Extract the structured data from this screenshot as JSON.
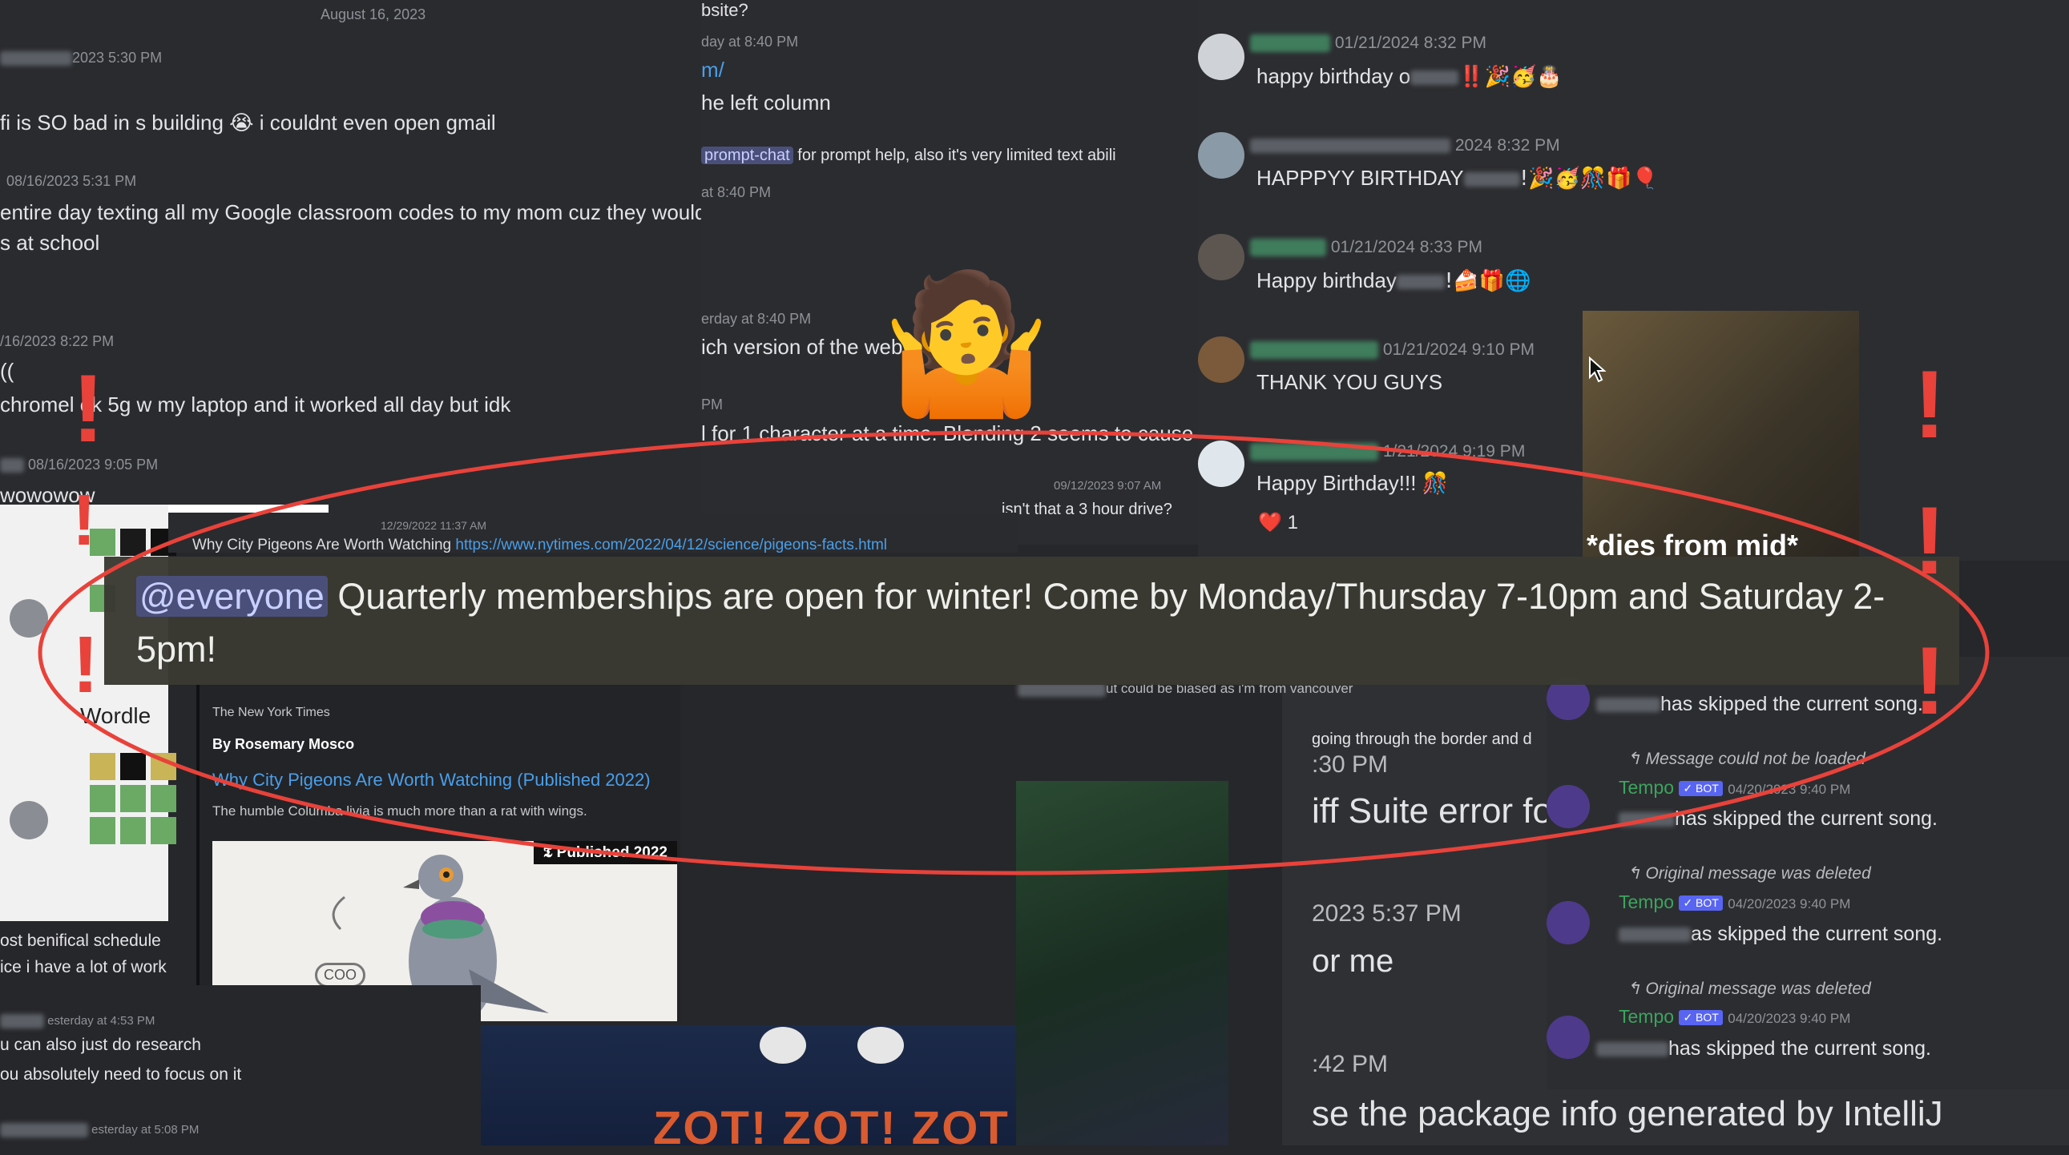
{
  "left_panel": {
    "date_divider": "August 16, 2023",
    "messages": [
      {
        "ts": "2023 5:30 PM",
        "text": "fi is SO bad in s building",
        "text2": "i couldnt even open gmail",
        "emoji": "😭"
      },
      {
        "ts": "08/16/2023 5:31 PM",
        "text": "entire day texting all my Google classroom codes to my mom cuz they wouldn",
        "text2": "s at school"
      },
      {
        "ts": "/16/2023 8:22 PM",
        "text": "((",
        "text2": "chromel    ok 5g w my laptop and it worked all day but idk"
      },
      {
        "ts": "08/16/2023 9:05 PM",
        "text": "wowowow"
      }
    ],
    "wordle_label": "Wordle",
    "bottom_lines": [
      "ost benifical schedule",
      "ice i have a lot of work"
    ],
    "bottom_ts": "esterday at 4:53 PM",
    "bottom_msgs": [
      "u can also just do research",
      "ou absolutely need to focus on it"
    ],
    "bottom_ts2": "esterday at 5:08 PM"
  },
  "mid_panel": {
    "lines": [
      {
        "ts": "",
        "text": "bsite?"
      },
      {
        "ts": "day at 8:40 PM",
        "text": "m/",
        "link": true
      },
      {
        "ts": "",
        "text": "he left column"
      },
      {
        "ts": "",
        "channel": "prompt-chat",
        "text": "for prompt help, also it's very limited text abili"
      },
      {
        "ts": "at 8:40 PM",
        "text": ""
      },
      {
        "ts": "erday at 8:40 PM",
        "text": "ich version of the webs"
      },
      {
        "ts": "PM",
        "text": "l for 1 character at a time. Blending 2 seems to cause e"
      }
    ],
    "ts_small": "09/12/2023 9:07 AM",
    "msg_small": "isn't that a 3 hour drive?",
    "shrug_emoji": "🤷"
  },
  "nyt": {
    "ts": "12/29/2022 11:37 AM",
    "title_line": "Why City Pigeons Are Worth Watching",
    "url": "https://www.nytimes.com/2022/04/12/science/pigeons-facts.html",
    "source": "The New York Times",
    "byline": "By Rosemary Mosco",
    "headline": "Why City Pigeons Are Worth Watching (Published 2022)",
    "desc": "The humble Columba livia is much more than a rat with wings.",
    "badge": "Published 2022",
    "coo": "COO"
  },
  "right_panel": {
    "messages": [
      {
        "ts": "01/21/2024 8:32 PM",
        "text": "happy birthday o",
        "emoji": "‼️🎉🥳🎂"
      },
      {
        "ts": "2024 8:32 PM",
        "text": "HAPPPYY BIRTHDAY",
        "emoji": "!🎉🥳🎊🎁🎈"
      },
      {
        "ts": "01/21/2024 8:33 PM",
        "text": "Happy birthday",
        "emoji": "!🍰🎁🌐"
      },
      {
        "ts": "01/21/2024 9:10 PM",
        "text": "THANK YOU GUYS"
      },
      {
        "ts": "1/21/2024 9:19 PM",
        "text": "Happy Birthday!!!",
        "emoji": "🎊"
      }
    ],
    "reaction": "❤️",
    "reaction_count": "1",
    "gif_caption": "*dies from mid*"
  },
  "banner": {
    "mention": "@everyone",
    "text": "Quarterly memberships are open for winter! Come by Monday/Thursday 7-10pm and Saturday 2-5pm!"
  },
  "bottom_right": {
    "lines": [
      {
        "text": "ut could be biased as i'm from vancouver"
      },
      {
        "text": "going through the border and d"
      },
      {
        "text": ":30 PM"
      },
      {
        "text": "iff Suite error fo"
      },
      {
        "text": "2023 5:37 PM"
      },
      {
        "text": "or me"
      },
      {
        "text": ":42 PM"
      },
      {
        "text": "se the package info generated by IntelliJ"
      }
    ]
  },
  "bot_log": {
    "entries": [
      {
        "reply": "",
        "name": "",
        "ts": "",
        "text": "has skipped the current song."
      },
      {
        "reply": "Message could not be loaded",
        "name": "Tempo",
        "badge": "✓ BOT",
        "ts": "04/20/2023 9:40 PM",
        "text": "has skipped the current song."
      },
      {
        "reply": "Original message was deleted",
        "name": "Tempo",
        "badge": "✓ BOT",
        "ts": "04/20/2023 9:40 PM",
        "text": "as skipped the current song."
      },
      {
        "reply": "Original message was deleted",
        "name": "Tempo",
        "badge": "✓ BOT",
        "ts": "04/20/2023 9:40 PM",
        "text": "has skipped the current song."
      }
    ]
  },
  "zot_text": "ZOT! ZOT! ZOT",
  "colors": {
    "accent_red": "#e8423a",
    "mention_bg": "#4a4f7a",
    "link": "#4a9fe8",
    "bot_badge": "#5865f2",
    "tempo_green": "#3ba55d"
  }
}
